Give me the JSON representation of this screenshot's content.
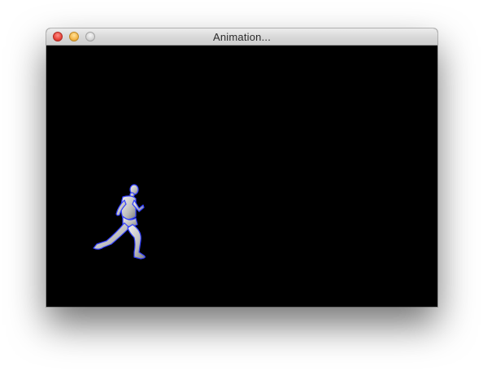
{
  "window": {
    "title": "Animation...",
    "canvas_background": "#000000"
  },
  "controls": {
    "close": "close-button",
    "minimize": "minimize-button",
    "zoom": "zoom-button"
  },
  "scene": {
    "figure": "running-man",
    "figure_outline_color": "#3340ff"
  }
}
